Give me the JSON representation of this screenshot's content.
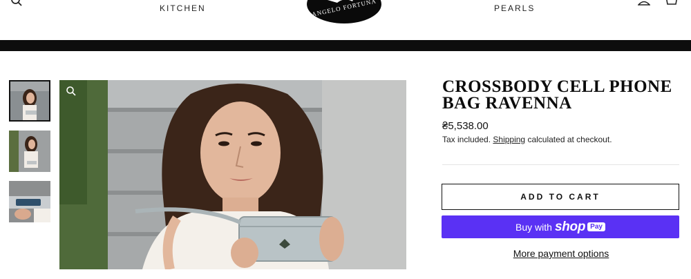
{
  "header": {
    "nav_left": "KITCHEN",
    "nav_right": "PEARLS",
    "logo_text": "ANGELO FORTUNA"
  },
  "icons": {
    "search": "search-icon",
    "account": "user-icon",
    "cart": "cart-icon",
    "zoom": "zoom-icon"
  },
  "gallery": {
    "thumbnails": [
      "photo-1",
      "photo-2",
      "photo-3"
    ],
    "active_index": 0
  },
  "product": {
    "title": "CROSSBODY CELL PHONE BAG RAVENNA",
    "price": "₴5,538.00",
    "tax_prefix": "Tax included.",
    "shipping_link": "Shipping",
    "tax_suffix": "calculated at checkout."
  },
  "buttons": {
    "add_to_cart": "ADD TO CART",
    "buy_with": "Buy with",
    "shop_brand": "shop",
    "shop_pay": "Pay",
    "more_payment": "More payment options"
  },
  "colors": {
    "shop_pay": "#5a31f4",
    "dark_bar": "#0d0d0d"
  }
}
